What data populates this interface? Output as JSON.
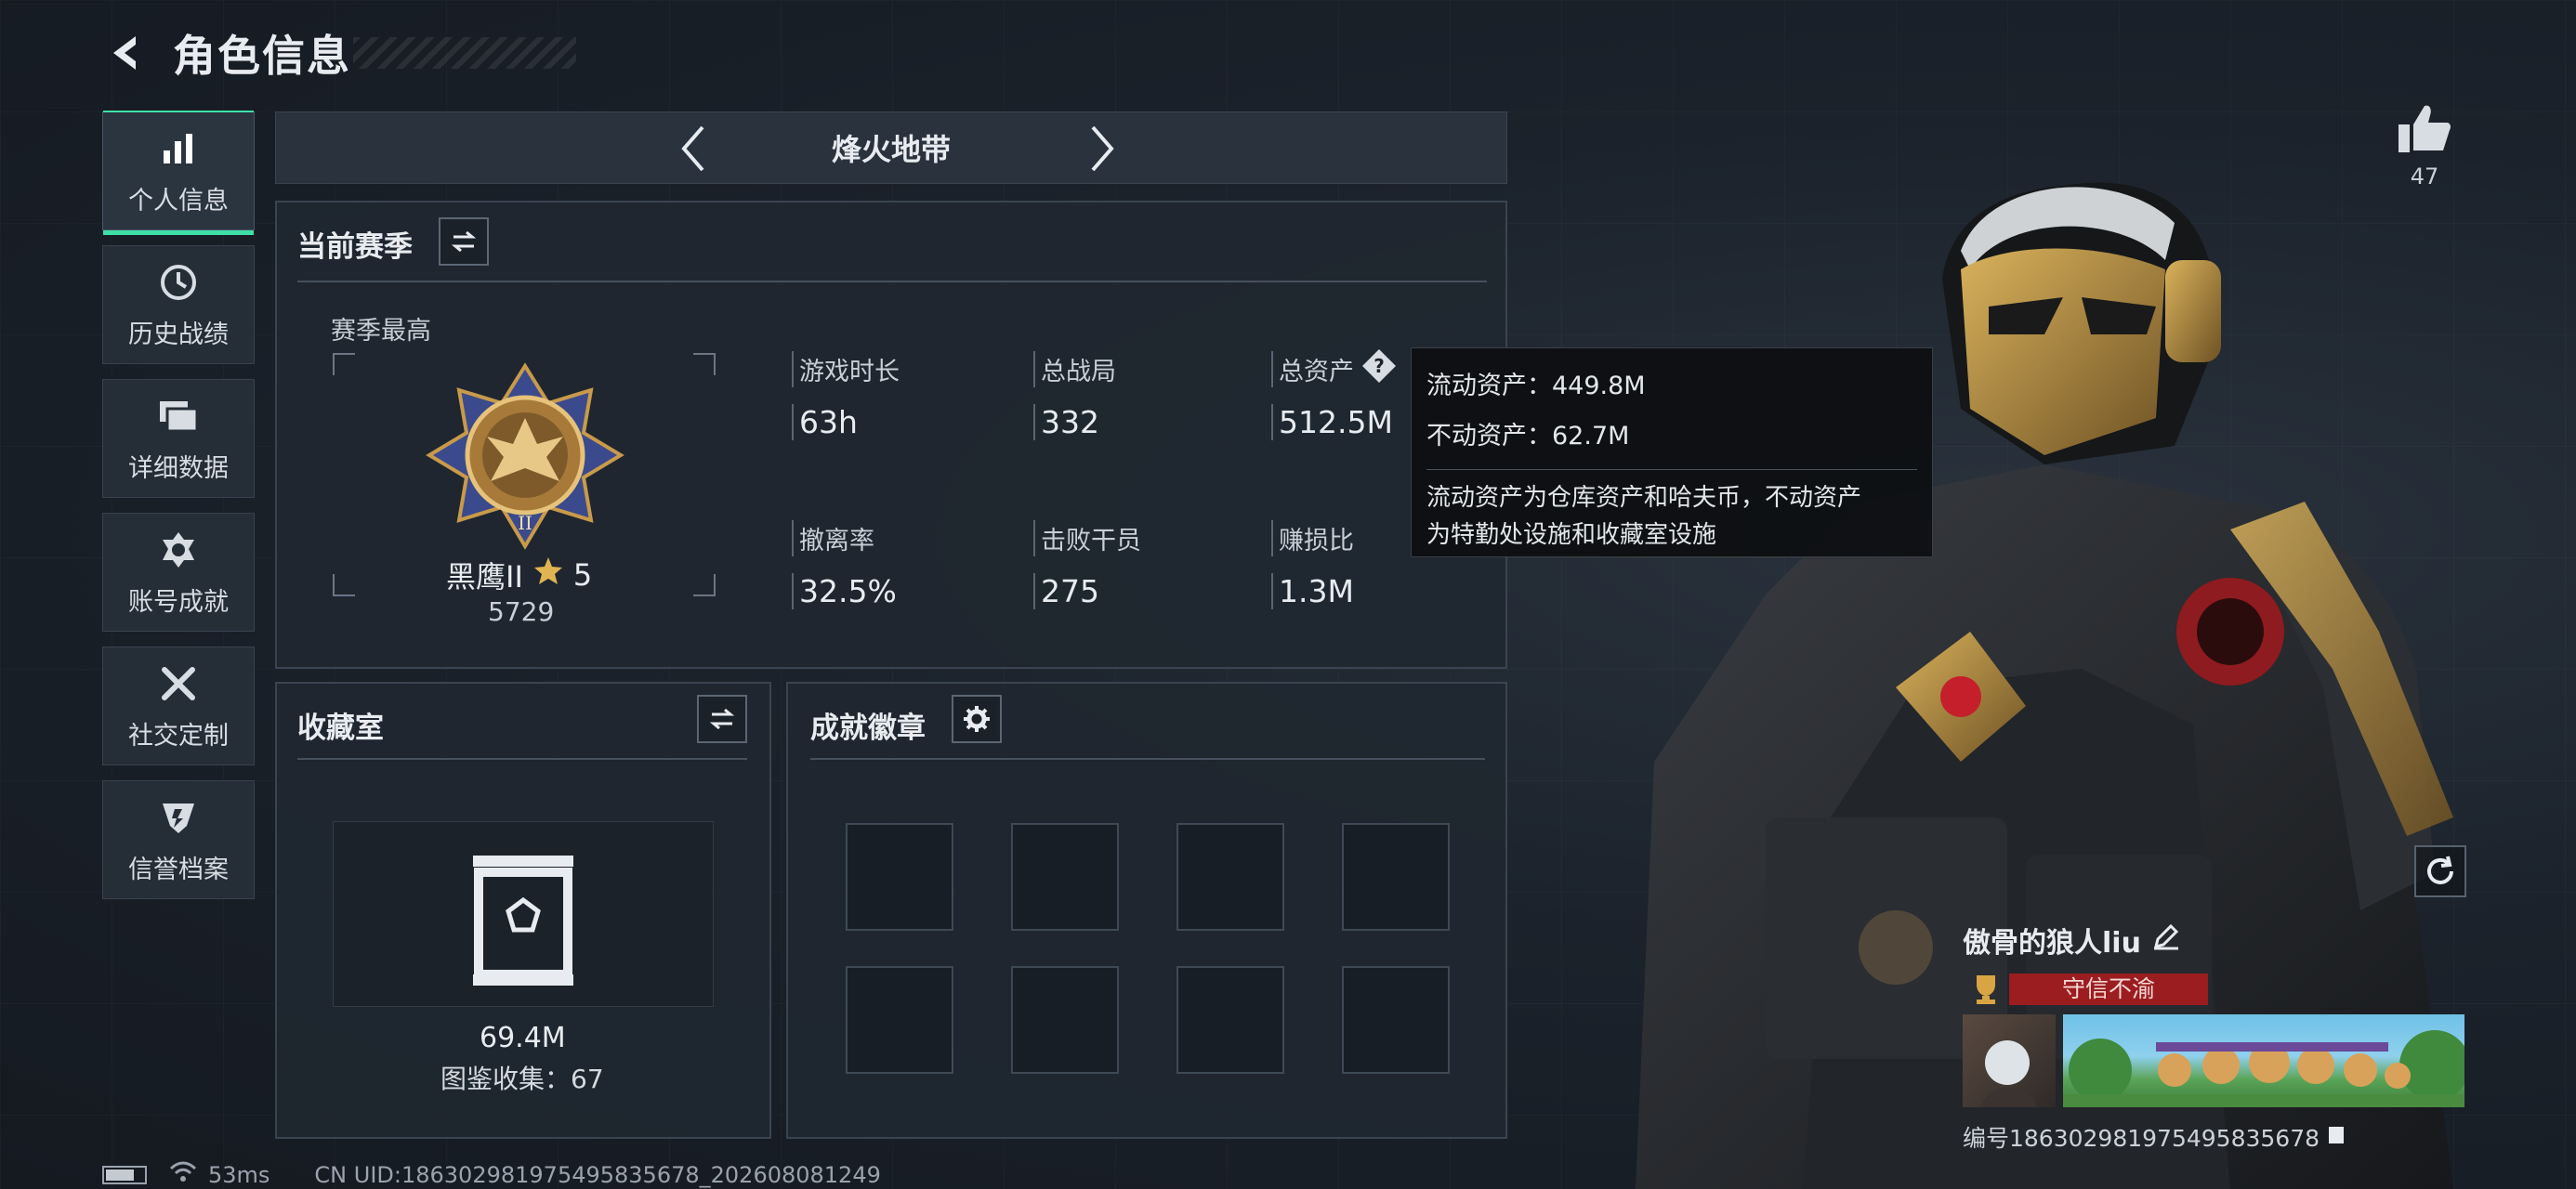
{
  "header": {
    "title": "角色信息"
  },
  "nav": {
    "items": [
      {
        "label": "个人信息",
        "icon": "bar-chart-icon",
        "active": true
      },
      {
        "label": "历史战绩",
        "icon": "clock-icon",
        "active": false
      },
      {
        "label": "详细数据",
        "icon": "folder-icon",
        "active": false
      },
      {
        "label": "账号成就",
        "icon": "medal-icon",
        "active": false
      },
      {
        "label": "社交定制",
        "icon": "tools-icon",
        "active": false
      },
      {
        "label": "信誉档案",
        "icon": "shield-icon",
        "active": false
      }
    ]
  },
  "mode": {
    "name": "烽火地带"
  },
  "season": {
    "title": "当前赛季",
    "best_label": "赛季最高",
    "rank_name": "黑鹰II",
    "rank_stars": "5",
    "rank_score": "5729",
    "stats": [
      {
        "label": "游戏时长",
        "value": "63h"
      },
      {
        "label": "总战局",
        "value": "332"
      },
      {
        "label": "总资产",
        "value": "512.5M"
      },
      {
        "label": "撤离率",
        "value": "32.5%"
      },
      {
        "label": "击败干员",
        "value": "275"
      },
      {
        "label": "赚损比",
        "value": "1.3M"
      }
    ]
  },
  "tooltip": {
    "liquid": "流动资产：449.8M",
    "fixed": "不动资产：62.7M",
    "desc_line1": "流动资产为仓库资产和哈夫币，不动资产",
    "desc_line2": "为特勤处设施和收藏室设施"
  },
  "vault": {
    "title": "收藏室",
    "value": "69.4M",
    "collection": "图鉴收集：67"
  },
  "badges": {
    "title": "成就徽章",
    "slots": 8
  },
  "player": {
    "name": "傲骨的狼人liu",
    "title": "守信不渝",
    "id": "编号18630298197549583567​8"
  },
  "likes": {
    "count": "47"
  },
  "footer": {
    "ping": "53ms",
    "uid": "CN UID:18630298197549583567​8_202608081249"
  },
  "colors": {
    "accent": "#3fe0a8",
    "title_red": "#9b1d20"
  }
}
